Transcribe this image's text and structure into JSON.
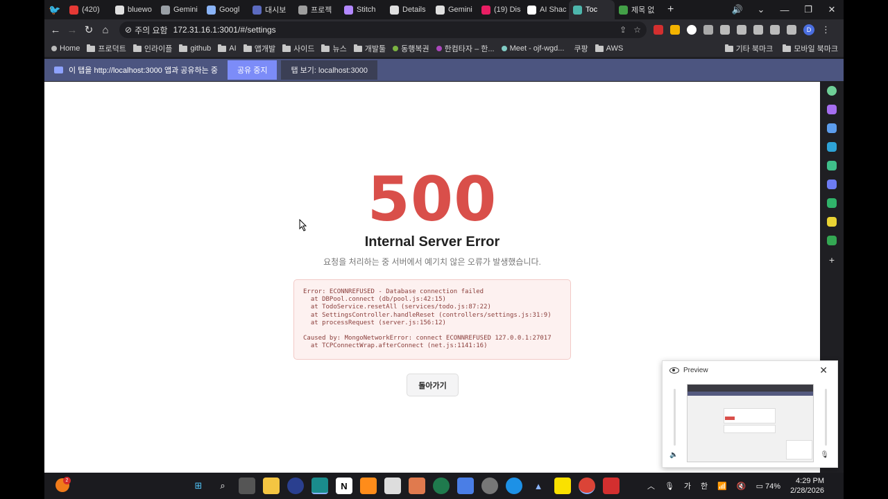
{
  "tabs": [
    {
      "label": "(420)",
      "color": "#e53935"
    },
    {
      "label": "bluewo",
      "color": "#e0e0e0"
    },
    {
      "label": "Gemini",
      "color": "#9aa0a6"
    },
    {
      "label": "Googl",
      "color": "#8ab4f8"
    },
    {
      "label": "대시보",
      "color": "#5c6bc0"
    },
    {
      "label": "프로젝",
      "color": "#9e9e9e"
    },
    {
      "label": "Stitch",
      "color": "#b388ff"
    },
    {
      "label": "Details",
      "color": "#e0e0e0"
    },
    {
      "label": "Gemini",
      "color": "#e0e0e0"
    },
    {
      "label": "(19) Dis",
      "color": "#e91e63"
    },
    {
      "label": "AI Shac",
      "color": "#ffffff"
    },
    {
      "label": "Toc",
      "color": "#4db6ac",
      "active": true
    },
    {
      "label": "제목 없",
      "color": "#43a047"
    }
  ],
  "toolbar": {
    "security_label": "주의 요함",
    "url": "172.31.16.1:3001/#/settings",
    "profile_letter": "D"
  },
  "bookmarks": {
    "items": [
      "Home",
      "프로덕트",
      "인라이플",
      "github",
      "AI",
      "앱개발",
      "사이드",
      "뉴스",
      "개발툴",
      "동행복권",
      "한컴타자 – 한...",
      "Meet - ojf-wgd...",
      "쿠팡",
      "AWS"
    ],
    "right": [
      "기타 북마크",
      "모바일 북마크"
    ]
  },
  "share_bar": {
    "message": "이 탭을 http://localhost:3000 앱과 공유하는 중",
    "stop_label": "공유 중지",
    "view_label": "탭 보기: localhost:3000"
  },
  "error_page": {
    "code": "500",
    "title": "Internal Server Error",
    "description": "요청을 처리하는 중 서버에서 예기치 않은 오류가 발생했습니다.",
    "stack_lines": [
      "Error: ECONNREFUSED - Database connection failed",
      "  at DBPool.connect (db/pool.js:42:15)",
      "  at TodoService.resetAll (services/todo.js:87:22)",
      "  at SettingsController.handleReset (controllers/settings.js:31:9)",
      "  at processRequest (server.js:156:12)",
      "",
      "Caused by: MongoNetworkError: connect ECONNREFUSED 127.0.0.1:27017",
      "  at TCPConnectWrap.afterConnect (net.js:1141:16)"
    ],
    "back_label": "돌아가기"
  },
  "preview": {
    "title": "Preview"
  },
  "taskbar": {
    "badge_count": "2",
    "tray_ime": "가",
    "tray_lang": "한",
    "battery": "74%",
    "time": "4:29 PM",
    "date": "2/28/2026"
  }
}
